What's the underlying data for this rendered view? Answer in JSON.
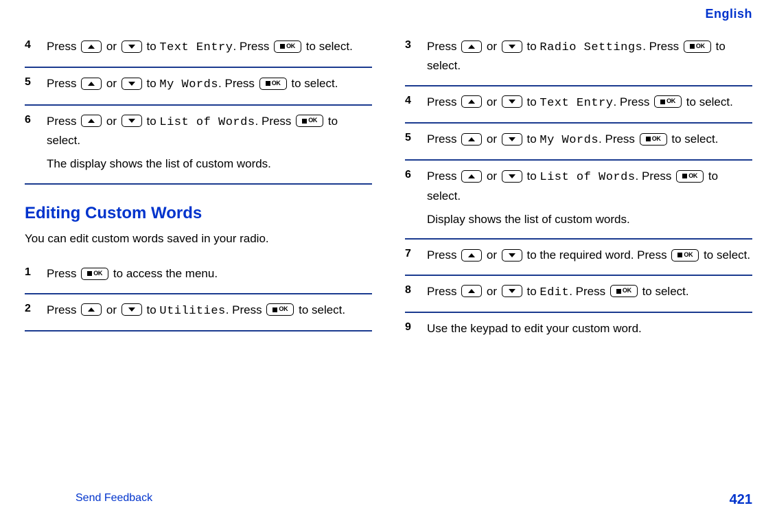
{
  "header": {
    "language": "English"
  },
  "left": {
    "steps_top": [
      {
        "num": "4",
        "text_pre": "Press ",
        "text_mid1": " or ",
        "text_mid2": " to ",
        "menu": "Text Entry",
        "text_mid3": ". Press ",
        "text_post": " to select."
      },
      {
        "num": "5",
        "text_pre": "Press ",
        "text_mid1": " or ",
        "text_mid2": " to ",
        "menu": "My Words",
        "text_mid3": ". Press ",
        "text_post": " to select."
      },
      {
        "num": "6",
        "text_pre": "Press ",
        "text_mid1": " or ",
        "text_mid2": " to ",
        "menu": "List of Words",
        "text_mid3": ". Press ",
        "text_post": " to select.",
        "extra": "The display shows the list of custom words."
      }
    ],
    "section": {
      "heading": "Editing Custom Words",
      "intro": "You can edit custom words saved in your radio."
    },
    "steps_bottom": [
      {
        "num": "1",
        "text_pre": "Press ",
        "text_post": " to access the menu."
      },
      {
        "num": "2",
        "text_pre": "Press ",
        "text_mid1": " or ",
        "text_mid2": " to ",
        "menu": "Utilities",
        "text_mid3": ". Press ",
        "text_post": " to select."
      }
    ]
  },
  "right": {
    "steps": [
      {
        "num": "3",
        "text_pre": "Press ",
        "text_mid1": " or ",
        "text_mid2": " to ",
        "menu": "Radio Settings",
        "text_mid3": ". Press ",
        "text_post": " to select."
      },
      {
        "num": "4",
        "text_pre": "Press ",
        "text_mid1": " or ",
        "text_mid2": " to ",
        "menu": "Text Entry",
        "text_mid3": ". Press ",
        "text_post": " to select."
      },
      {
        "num": "5",
        "text_pre": "Press ",
        "text_mid1": " or ",
        "text_mid2": " to ",
        "menu": "My Words",
        "text_mid3": ". Press ",
        "text_post": " to select."
      },
      {
        "num": "6",
        "text_pre": "Press ",
        "text_mid1": " or ",
        "text_mid2": " to ",
        "menu": "List of Words",
        "text_mid3": ". Press ",
        "text_post": " to select.",
        "extra": "Display shows the list of custom words."
      },
      {
        "num": "7",
        "text_pre": "Press ",
        "text_mid1": " or ",
        "text_mid2": " to the required word. Press ",
        "text_post": " to select."
      },
      {
        "num": "8",
        "text_pre": "Press ",
        "text_mid1": " or ",
        "text_mid2": " to ",
        "menu": "Edit",
        "text_mid3": ". Press ",
        "text_post": " to select."
      },
      {
        "num": "9",
        "plain": "Use the keypad to edit your custom word."
      }
    ]
  },
  "footer": {
    "feedback": "Send Feedback",
    "page": "421"
  },
  "icons": {
    "ok_label": "OK"
  }
}
